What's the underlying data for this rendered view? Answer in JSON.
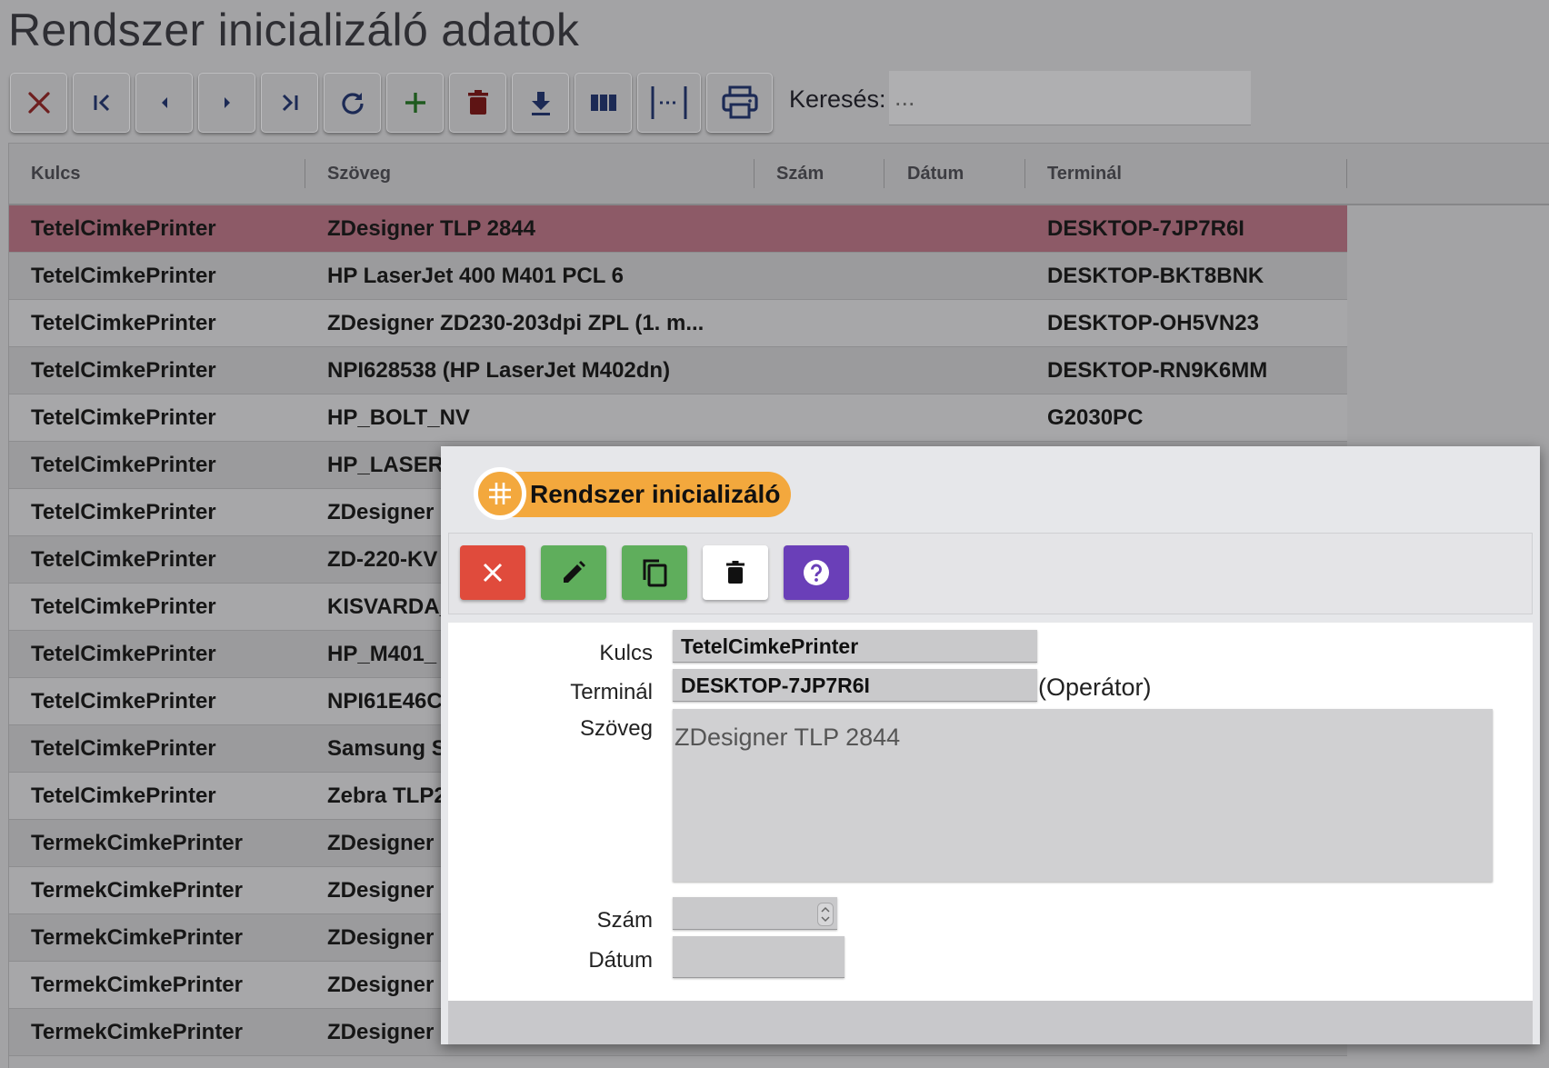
{
  "page": {
    "title": "Rendszer inicializáló adatok"
  },
  "toolbar": {
    "buttons": [
      {
        "name": "close",
        "icon": "close-icon"
      },
      {
        "name": "first",
        "icon": "first-page-icon"
      },
      {
        "name": "prev",
        "icon": "chevron-left-icon"
      },
      {
        "name": "next",
        "icon": "chevron-right-icon"
      },
      {
        "name": "last",
        "icon": "last-page-icon"
      },
      {
        "name": "refresh",
        "icon": "refresh-icon"
      },
      {
        "name": "add",
        "icon": "plus-icon"
      },
      {
        "name": "delete",
        "icon": "trash-icon"
      },
      {
        "name": "download",
        "icon": "download-icon"
      },
      {
        "name": "columns",
        "icon": "columns-icon"
      },
      {
        "name": "fit-width",
        "icon": "fit-width-icon"
      },
      {
        "name": "print",
        "icon": "printer-icon"
      }
    ],
    "search_label": "Keresés:",
    "search_placeholder": "..."
  },
  "grid": {
    "columns": [
      "Kulcs",
      "Szöveg",
      "Szám",
      "Dátum",
      "Terminál"
    ],
    "rows": [
      {
        "key": "TetelCimkePrinter",
        "text": "ZDesigner TLP 2844",
        "terminal": "DESKTOP-7JP7R6I",
        "selected": true
      },
      {
        "key": "TetelCimkePrinter",
        "text": "HP LaserJet 400 M401 PCL 6",
        "terminal": "DESKTOP-BKT8BNK"
      },
      {
        "key": "TetelCimkePrinter",
        "text": "ZDesigner ZD230-203dpi ZPL (1. m...",
        "terminal": "DESKTOP-OH5VN23"
      },
      {
        "key": "TetelCimkePrinter",
        "text": "NPI628538 (HP LaserJet M402dn)",
        "terminal": "DESKTOP-RN9K6MM"
      },
      {
        "key": "TetelCimkePrinter",
        "text": "HP_BOLT_NV",
        "terminal": "G2030PC"
      },
      {
        "key": "TetelCimkePrinter",
        "text": "HP_LASER_",
        "terminal": ""
      },
      {
        "key": "TetelCimkePrinter",
        "text": "ZDesigner",
        "terminal": ""
      },
      {
        "key": "TetelCimkePrinter",
        "text": "ZD-220-KV",
        "terminal": ""
      },
      {
        "key": "TetelCimkePrinter",
        "text": "KISVARDA_",
        "terminal": ""
      },
      {
        "key": "TetelCimkePrinter",
        "text": "HP_M401_",
        "terminal": ""
      },
      {
        "key": "TetelCimkePrinter",
        "text": "NPI61E46C",
        "terminal": ""
      },
      {
        "key": "TetelCimkePrinter",
        "text": "Samsung S",
        "terminal": ""
      },
      {
        "key": "TetelCimkePrinter",
        "text": "Zebra TLP2",
        "terminal": ""
      },
      {
        "key": "TermekCimkePrinter",
        "text": "ZDesigner",
        "terminal": ""
      },
      {
        "key": "TermekCimkePrinter",
        "text": "ZDesigner",
        "terminal": ""
      },
      {
        "key": "TermekCimkePrinter",
        "text": "ZDesigner",
        "terminal": ""
      },
      {
        "key": "TermekCimkePrinter",
        "text": "ZDesigner",
        "terminal": ""
      },
      {
        "key": "TermekCimkePrinter",
        "text": "ZDesigner",
        "terminal": ""
      }
    ]
  },
  "dialog": {
    "title": "Rendszer inicializáló",
    "buttons": [
      {
        "name": "close",
        "icon": "close-icon",
        "color": "#e04b3c"
      },
      {
        "name": "edit",
        "icon": "pencil-icon",
        "color": "#5fae5c"
      },
      {
        "name": "copy",
        "icon": "copy-icon",
        "color": "#5fae5c"
      },
      {
        "name": "delete",
        "icon": "trash-icon",
        "color": "#ffffff"
      },
      {
        "name": "help",
        "icon": "help-icon",
        "color": "#6a3fb8"
      }
    ],
    "form": {
      "key_label": "Kulcs",
      "key_value": "TetelCimkePrinter",
      "terminal_label": "Terminál",
      "terminal_value": "DESKTOP-7JP7R6I",
      "operator_note": "(Operátor)",
      "text_label": "Szöveg",
      "text_value": "ZDesigner TLP 2844",
      "number_label": "Szám",
      "number_value": "",
      "date_label": "Dátum",
      "date_value": ""
    }
  },
  "colors": {
    "selected_row": "#8d5a67",
    "accent_orange": "#f3a83d",
    "danger_red": "#e04b3c",
    "success_green": "#5fae5c",
    "help_purple": "#6a3fb8"
  }
}
